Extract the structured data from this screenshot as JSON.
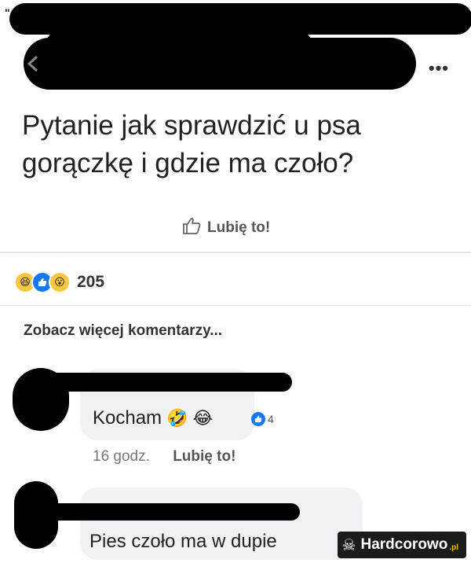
{
  "header": {
    "more_icon": "more-dots-icon",
    "back_icon": "chevron-left-icon"
  },
  "post": {
    "text": "Pytanie jak sprawdzić u psa gorączkę i gdzie ma czoło?",
    "like_label": "Lubię to!",
    "like_icon": "thumbs-up-icon"
  },
  "reactions": {
    "icons": [
      "haha-emoji-icon",
      "like-icon",
      "wow-emoji-icon"
    ],
    "count": "205"
  },
  "more_comments": "Zobacz więcej komentarzy...",
  "comments": [
    {
      "text": "Kocham",
      "reaction_count": "4",
      "time": "16 godz.",
      "like_label": "Lubię to!"
    },
    {
      "text": "Pies czoło ma w dupie"
    }
  ],
  "watermark": {
    "name": "Hardcorowo",
    "suffix": ".pl"
  },
  "colors": {
    "redaction": "#000000",
    "bubble": "#f0f2f5",
    "like_blue": "#1877f2",
    "emoji_yellow": "#f7c744"
  }
}
